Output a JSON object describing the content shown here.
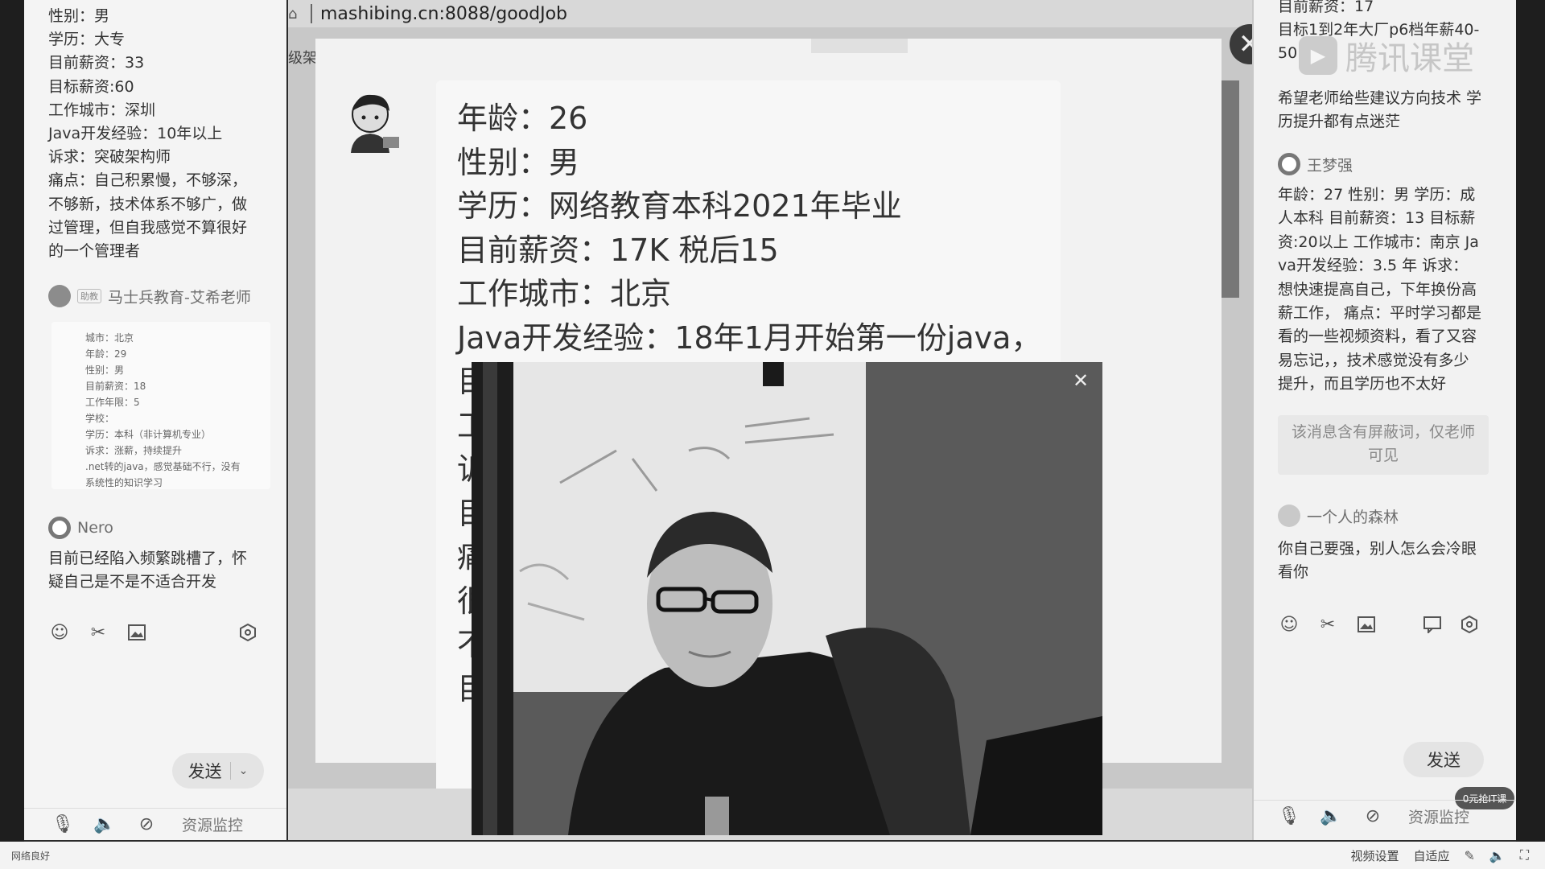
{
  "left_panel": {
    "profile_lines": [
      "性别：男",
      "学历：大专",
      "目前薪资：33",
      "目标薪资:60",
      "工作城市：深圳",
      "Java开发经验：10年以上",
      "诉求：突破架构师",
      "痛点：自己积累慢，不够深，",
      "不够新，技术体系不够广，做",
      "过管理，但自我感觉不算很好",
      "的一个管理者"
    ],
    "assistant": {
      "tag": "助教",
      "name": "马士兵教育-艾希老师"
    },
    "image_card_lines": [
      "城市：北京",
      "年龄：29",
      "性别：男",
      "目前薪资：18",
      "工作年限：5",
      "学校：",
      "学历：本科（非计算机专业）",
      "诉求：涨薪，持续提升",
      ".net转的java，感觉基础不行，没有",
      "系统性的知识学习"
    ],
    "nero": {
      "name": "Nero",
      "lines": [
        "目前已经陷入频繁跳槽了，怀",
        "疑自己是不是不适合开发"
      ]
    },
    "send_label": "发送",
    "resource_label": "资源监控"
  },
  "screen": {
    "url": "mashibing.cn:8088/goodJob",
    "side_label": "级架",
    "post_lines": [
      "年龄：26",
      "性别：男",
      "学历：网络教育本科2021年毕业",
      "目前薪资：17K 税后15",
      "工作城市：北京",
      "Java开发经验：18年1月开始第一份java，",
      "目",
      "工",
      "诉",
      "目",
      "痛",
      "很",
      "",
      "不",
      "目"
    ]
  },
  "right_panel": {
    "top_lines": [
      "目前薪资：17",
      "目标1到2年大厂p6档年薪40-",
      "50"
    ],
    "watermark": "腾讯课堂",
    "msg1_lines": [
      "希望老师给些建议方向技术 学",
      "历提升都有点迷茫"
    ],
    "user2": {
      "name": "王梦强",
      "lines": [
        "年龄：27 性别：男 学历：成",
        "人本科 目前薪资：13 目标薪",
        "资:20以上 工作城市：南京 Ja",
        "va开发经验：3.5   年 诉求：",
        "想快速提高自己，下年换份高",
        "薪工作， 痛点：平时学习都是",
        "看的一些视频资料，看了又容",
        "易忘记，，技术感觉没有多少",
        "提升，而且学历也不太好"
      ]
    },
    "blocked_lines": [
      "该消息含有屏蔽词，仅老师",
      "可见"
    ],
    "user3": {
      "name": "一个人的森林",
      "lines": [
        "你自己要强，别人怎么会冷眼",
        "看你"
      ]
    },
    "send_label": "发送",
    "promo_badge": "0元抢IT课",
    "resource_label": "资源监控"
  },
  "status_bar": {
    "network": "网络良好",
    "video_settings": "视频设置",
    "fit": "自适应"
  }
}
